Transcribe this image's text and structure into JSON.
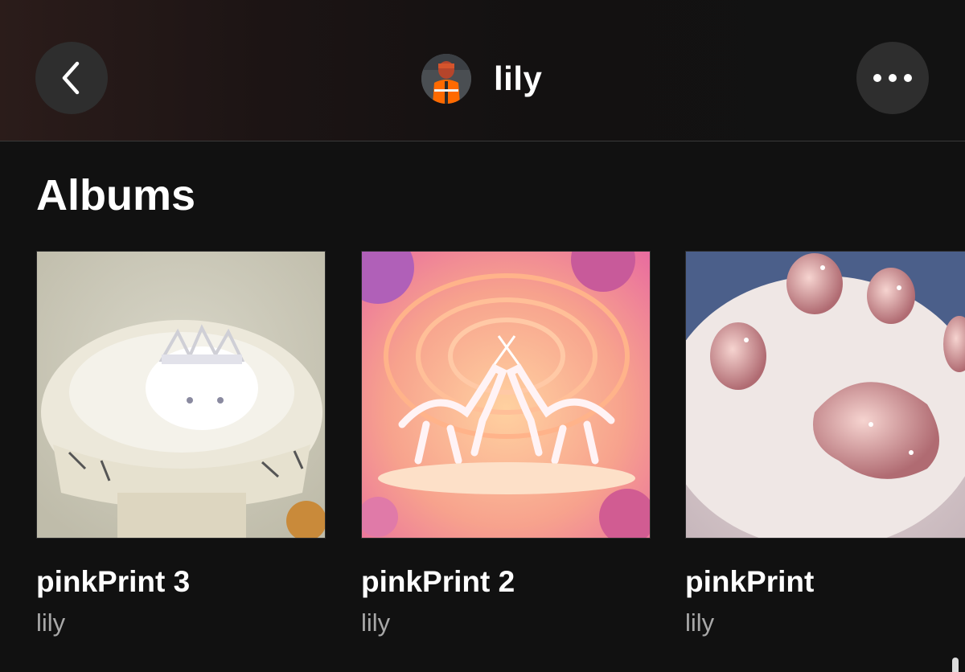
{
  "header": {
    "back_icon": "chevron-left-icon",
    "more_icon": "more-horizontal-icon",
    "profile_name": "lily"
  },
  "section": {
    "title": "Albums"
  },
  "albums": [
    {
      "title": "pinkPrint 3",
      "artist": "lily",
      "cover": "white kitten wearing a jeweled crown in an ornate bowl"
    },
    {
      "title": "pinkPrint 2",
      "artist": "lily",
      "cover": "two white unicorns on a pink and orange swirl background"
    },
    {
      "title": "pinkPrint",
      "artist": "lily",
      "cover": "cat paw with glittery pink toe beans"
    }
  ],
  "colors": {
    "background": "#111111",
    "button_bg": "#2e2e2e",
    "secondary_text": "#a8a8a8",
    "avatar_vest": "#ff6a00"
  }
}
